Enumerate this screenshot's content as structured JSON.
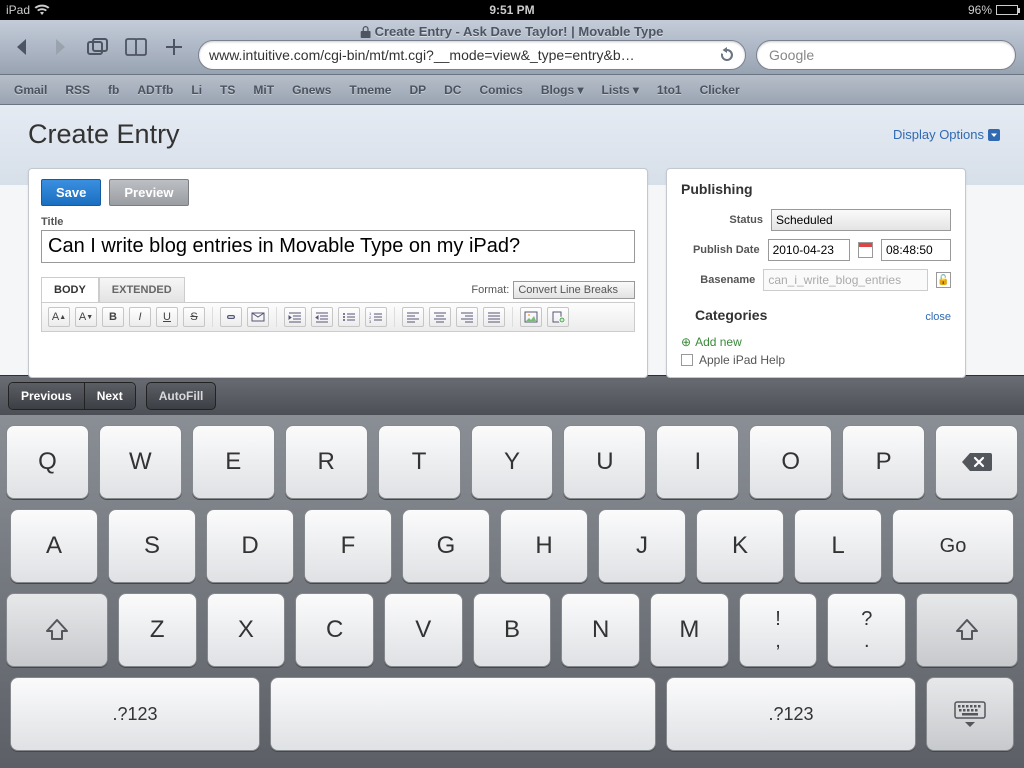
{
  "statusbar": {
    "device": "iPad",
    "time": "9:51 PM",
    "battery_pct": "96%"
  },
  "safari": {
    "page_title": "Create Entry - Ask Dave Taylor! | Movable Type",
    "url": "www.intuitive.com/cgi-bin/mt/mt.cgi?__mode=view&_type=entry&b…",
    "search_placeholder": "Google"
  },
  "bookmarks": [
    "Gmail",
    "RSS",
    "fb",
    "ADTfb",
    "Li",
    "TS",
    "MiT",
    "Gnews",
    "Tmeme",
    "DP",
    "DC",
    "Comics",
    "Blogs ▾",
    "Lists ▾",
    "1to1",
    "Clicker"
  ],
  "page": {
    "heading": "Create Entry",
    "display_options": "Display Options",
    "save": "Save",
    "preview": "Preview",
    "title_label": "Title",
    "title_value": "Can I write blog entries in Movable Type on my iPad?",
    "tabs": {
      "body": "BODY",
      "extended": "EXTENDED"
    },
    "format_label": "Format:",
    "format_value": "Convert Line Breaks"
  },
  "publishing": {
    "heading": "Publishing",
    "status_label": "Status",
    "status_value": "Scheduled",
    "date_label": "Publish Date",
    "date_value": "2010-04-23",
    "time_value": "08:48:50",
    "basename_label": "Basename",
    "basename_value": "can_i_write_blog_entries"
  },
  "categories": {
    "heading": "Categories",
    "close": "close",
    "add_new": "Add new",
    "item1": "Apple iPad Help"
  },
  "accessory": {
    "prev": "Previous",
    "next": "Next",
    "autofill": "AutoFill"
  },
  "keys": {
    "row1": [
      "Q",
      "W",
      "E",
      "R",
      "T",
      "Y",
      "U",
      "I",
      "O",
      "P"
    ],
    "row2": [
      "A",
      "S",
      "D",
      "F",
      "G",
      "H",
      "J",
      "K",
      "L"
    ],
    "row3": [
      "Z",
      "X",
      "C",
      "V",
      "B",
      "N",
      "M"
    ],
    "go": "Go",
    "sym": ".?123",
    "punc1_top": "!",
    "punc1_bot": ",",
    "punc2_top": "?",
    "punc2_bot": "."
  }
}
